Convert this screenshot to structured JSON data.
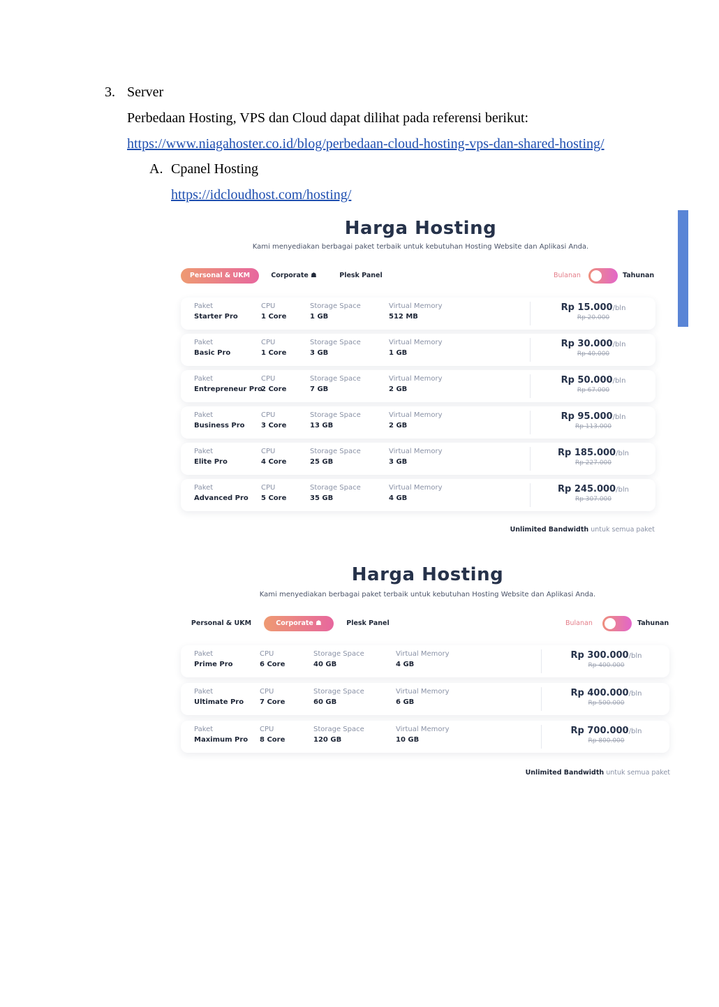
{
  "document": {
    "item_number": "3.",
    "item_title": "Server",
    "intro": "Perbedaan Hosting, VPS dan Cloud dapat dilihat pada referensi berikut:",
    "intro_link": "https://www.niagahoster.co.id/blog/perbedaan-cloud-hosting-vps-dan-shared-hosting/",
    "sub_item_letter": "A.",
    "sub_item_title": "Cpanel Hosting",
    "sub_item_link": "https://idcloudhost.com/hosting/"
  },
  "accent_colors": {
    "gradient_start": "#ee9a72",
    "gradient_end": "#e7679e",
    "sidebar_bar": "#5a85d6",
    "title": "#26324a"
  },
  "panels": [
    {
      "title": "Harga Hosting",
      "subtitle": "Kami menyediakan berbagai paket terbaik untuk kebutuhan Hosting Website dan Aplikasi Anda.",
      "tabs": [
        {
          "label": "Personal & UKM",
          "active": true
        },
        {
          "label": "Corporate ☗",
          "active": false
        },
        {
          "label": "Plesk Panel",
          "active": false
        }
      ],
      "billing": {
        "monthly": "Bulanan",
        "yearly": "Tahunan"
      },
      "labels": {
        "paket": "Paket",
        "cpu": "CPU",
        "storage": "Storage Space",
        "memory": "Virtual Memory"
      },
      "rows": [
        {
          "name": "Starter Pro",
          "cpu": "1 Core",
          "storage": "1 GB",
          "memory": "512 MB",
          "price": "Rp 15.000",
          "per": "/bln",
          "old_price": "Rp 20.000"
        },
        {
          "name": "Basic Pro",
          "cpu": "1 Core",
          "storage": "3 GB",
          "memory": "1 GB",
          "price": "Rp 30.000",
          "per": "/bln",
          "old_price": "Rp 40.000"
        },
        {
          "name": "Entrepreneur Pro",
          "cpu": "2 Core",
          "storage": "7 GB",
          "memory": "2 GB",
          "price": "Rp 50.000",
          "per": "/bln",
          "old_price": "Rp 67.000"
        },
        {
          "name": "Business Pro",
          "cpu": "3 Core",
          "storage": "13 GB",
          "memory": "2 GB",
          "price": "Rp 95.000",
          "per": "/bln",
          "old_price": "Rp 113.000"
        },
        {
          "name": "Elite Pro",
          "cpu": "4 Core",
          "storage": "25 GB",
          "memory": "3 GB",
          "price": "Rp 185.000",
          "per": "/bln",
          "old_price": "Rp 227.000"
        },
        {
          "name": "Advanced Pro",
          "cpu": "5 Core",
          "storage": "35 GB",
          "memory": "4 GB",
          "price": "Rp 245.000",
          "per": "/bln",
          "old_price": "Rp 307.000"
        }
      ],
      "footer_bold": "Unlimited Bandwidth",
      "footer_rest": "untuk semua paket"
    },
    {
      "title": "Harga Hosting",
      "subtitle": "Kami menyediakan berbagai paket terbaik untuk kebutuhan Hosting Website dan Aplikasi Anda.",
      "tabs": [
        {
          "label": "Personal & UKM",
          "active": false
        },
        {
          "label": "Corporate ☗",
          "active": true
        },
        {
          "label": "Plesk Panel",
          "active": false
        }
      ],
      "billing": {
        "monthly": "Bulanan",
        "yearly": "Tahunan"
      },
      "labels": {
        "paket": "Paket",
        "cpu": "CPU",
        "storage": "Storage Space",
        "memory": "Virtual Memory"
      },
      "rows": [
        {
          "name": "Prime Pro",
          "cpu": "6 Core",
          "storage": "40 GB",
          "memory": "4 GB",
          "price": "Rp 300.000",
          "per": "/bln",
          "old_price": "Rp 400.000"
        },
        {
          "name": "Ultimate Pro",
          "cpu": "7 Core",
          "storage": "60 GB",
          "memory": "6 GB",
          "price": "Rp 400.000",
          "per": "/bln",
          "old_price": "Rp 500.000"
        },
        {
          "name": "Maximum Pro",
          "cpu": "8 Core",
          "storage": "120 GB",
          "memory": "10 GB",
          "price": "Rp 700.000",
          "per": "/bln",
          "old_price": "Rp 800.000"
        }
      ],
      "footer_bold": "Unlimited Bandwidth",
      "footer_rest": "untuk semua paket"
    }
  ]
}
